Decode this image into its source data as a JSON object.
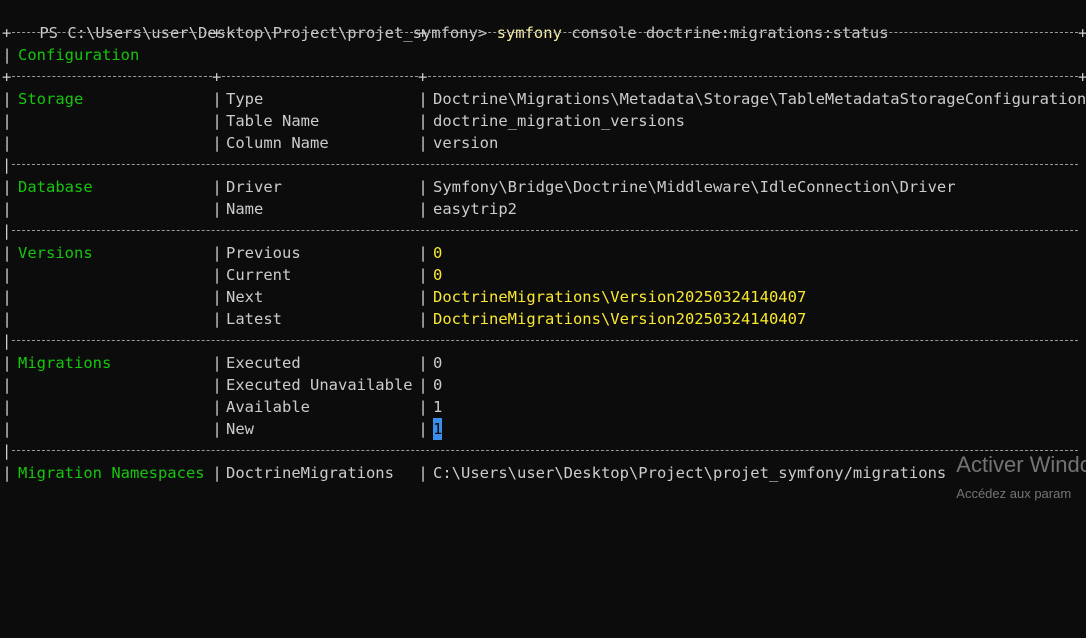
{
  "prompt": {
    "path": "PS C:\\Users\\user\\Desktop\\Project\\projet_symfony> ",
    "command": "symfony",
    "args": " console doctrine:migrations:status"
  },
  "table": {
    "header": "Configuration",
    "sections": [
      {
        "name": "Storage",
        "rows": [
          {
            "key": "Type",
            "value": "Doctrine\\Migrations\\Metadata\\Storage\\TableMetadataStorageConfiguration"
          },
          {
            "key": "Table Name",
            "value": "doctrine_migration_versions"
          },
          {
            "key": "Column Name",
            "value": "version"
          }
        ]
      },
      {
        "name": "Database",
        "rows": [
          {
            "key": "Driver",
            "value": "Symfony\\Bridge\\Doctrine\\Middleware\\IdleConnection\\Driver"
          },
          {
            "key": "Name",
            "value": "easytrip2"
          }
        ]
      },
      {
        "name": "Versions",
        "rows": [
          {
            "key": "Previous",
            "value": "0"
          },
          {
            "key": "Current",
            "value": "0"
          },
          {
            "key": "Next",
            "value": "DoctrineMigrations\\Version20250324140407"
          },
          {
            "key": "Latest",
            "value": "DoctrineMigrations\\Version20250324140407"
          }
        ]
      },
      {
        "name": "Migrations",
        "rows": [
          {
            "key": "Executed",
            "value": "0"
          },
          {
            "key": "Executed Unavailable",
            "value": "0"
          },
          {
            "key": "Available",
            "value": "1"
          },
          {
            "key": "New",
            "value": "1"
          }
        ]
      },
      {
        "name": "Migration Namespaces",
        "rows": [
          {
            "key": "DoctrineMigrations",
            "value": "C:\\Users\\user\\Desktop\\Project\\projet_symfony/migrations"
          }
        ]
      }
    ]
  },
  "watermark": {
    "title": "Activer Windo",
    "subtitle": "Accédez aux param"
  },
  "colors": {
    "background": "#0c0c0c",
    "text": "#cccccc",
    "section": "#16c60c",
    "command": "#f9f1a5",
    "version_value": "#f9e82f",
    "cursor": "#3b8eea"
  }
}
